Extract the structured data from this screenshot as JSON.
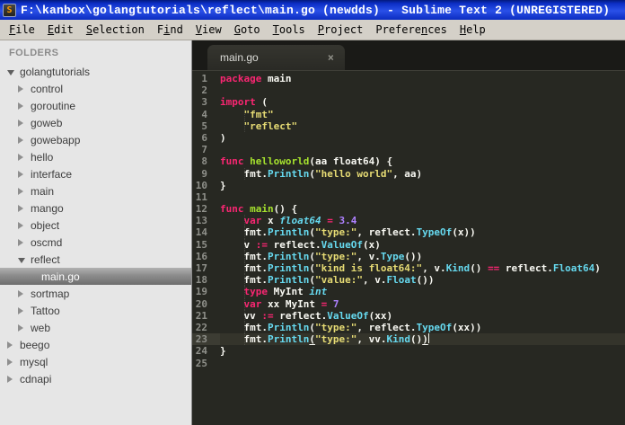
{
  "window": {
    "title": "F:\\kanbox\\golangtutorials\\reflect\\main.go (newdds) - Sublime Text 2 (UNREGISTERED)",
    "icon_letter": "S"
  },
  "menu": {
    "items": [
      {
        "label": "File",
        "mnemonic_index": 0
      },
      {
        "label": "Edit",
        "mnemonic_index": 0
      },
      {
        "label": "Selection",
        "mnemonic_index": 0
      },
      {
        "label": "Find",
        "mnemonic_index": 1
      },
      {
        "label": "View",
        "mnemonic_index": 0
      },
      {
        "label": "Goto",
        "mnemonic_index": 0
      },
      {
        "label": "Tools",
        "mnemonic_index": 0
      },
      {
        "label": "Project",
        "mnemonic_index": 0
      },
      {
        "label": "Preferences",
        "mnemonic_index": 7
      },
      {
        "label": "Help",
        "mnemonic_index": 0
      }
    ]
  },
  "sidebar": {
    "header": "FOLDERS",
    "items": [
      {
        "label": "golangtutorials",
        "level": 0,
        "state": "expanded",
        "selected": false
      },
      {
        "label": "control",
        "level": 1,
        "state": "collapsed",
        "selected": false
      },
      {
        "label": "goroutine",
        "level": 1,
        "state": "collapsed",
        "selected": false
      },
      {
        "label": "goweb",
        "level": 1,
        "state": "collapsed",
        "selected": false
      },
      {
        "label": "gowebapp",
        "level": 1,
        "state": "collapsed",
        "selected": false
      },
      {
        "label": "hello",
        "level": 1,
        "state": "collapsed",
        "selected": false
      },
      {
        "label": "interface",
        "level": 1,
        "state": "collapsed",
        "selected": false
      },
      {
        "label": "main",
        "level": 1,
        "state": "collapsed",
        "selected": false
      },
      {
        "label": "mango",
        "level": 1,
        "state": "collapsed",
        "selected": false
      },
      {
        "label": "object",
        "level": 1,
        "state": "collapsed",
        "selected": false
      },
      {
        "label": "oscmd",
        "level": 1,
        "state": "collapsed",
        "selected": false
      },
      {
        "label": "reflect",
        "level": 1,
        "state": "expanded",
        "selected": false
      },
      {
        "label": "main.go",
        "level": 2,
        "state": "file",
        "selected": true
      },
      {
        "label": "sortmap",
        "level": 1,
        "state": "collapsed",
        "selected": false
      },
      {
        "label": "Tattoo",
        "level": 1,
        "state": "collapsed",
        "selected": false
      },
      {
        "label": "web",
        "level": 1,
        "state": "collapsed",
        "selected": false
      },
      {
        "label": "beego",
        "level": 0,
        "state": "collapsed",
        "selected": false
      },
      {
        "label": "mysql",
        "level": 0,
        "state": "collapsed",
        "selected": false
      },
      {
        "label": "cdnapi",
        "level": 0,
        "state": "collapsed",
        "selected": false
      }
    ]
  },
  "tabbar": {
    "tab_label": "main.go",
    "close_icon": "×"
  },
  "editor": {
    "language": "go",
    "theme_colors": {
      "background": "#272822",
      "keyword": "#f92672",
      "function_name": "#a6e22e",
      "type": "#66d9ef",
      "string": "#e6db74",
      "number": "#ae81ff",
      "plain": "#f8f8f2",
      "line_number": "#8f908a",
      "current_line": "#34342b"
    },
    "lines": [
      {
        "num": 1,
        "tokens": [
          [
            "k",
            "package"
          ],
          [
            "p",
            " main"
          ]
        ]
      },
      {
        "num": 2,
        "tokens": []
      },
      {
        "num": 3,
        "tokens": [
          [
            "k",
            "import"
          ],
          [
            "p",
            " ("
          ]
        ]
      },
      {
        "num": 4,
        "tokens": [
          [
            "p",
            "    "
          ],
          [
            "s",
            "\"fmt\""
          ]
        ]
      },
      {
        "num": 5,
        "tokens": [
          [
            "p",
            "    "
          ],
          [
            "s",
            "\"reflect\""
          ]
        ]
      },
      {
        "num": 6,
        "tokens": [
          [
            "p",
            ")"
          ]
        ]
      },
      {
        "num": 7,
        "tokens": []
      },
      {
        "num": 8,
        "tokens": [
          [
            "k",
            "func"
          ],
          [
            "p",
            " "
          ],
          [
            "f",
            "helloworld"
          ],
          [
            "p",
            "(aa float64) {"
          ]
        ]
      },
      {
        "num": 9,
        "tokens": [
          [
            "p",
            "    fmt."
          ],
          [
            "m",
            "Println"
          ],
          [
            "p",
            "("
          ],
          [
            "s",
            "\"hello world\""
          ],
          [
            "p",
            ", aa)"
          ]
        ]
      },
      {
        "num": 10,
        "tokens": [
          [
            "p",
            "}"
          ]
        ]
      },
      {
        "num": 11,
        "tokens": []
      },
      {
        "num": 12,
        "tokens": [
          [
            "k",
            "func"
          ],
          [
            "p",
            " "
          ],
          [
            "f",
            "main"
          ],
          [
            "p",
            "() {"
          ]
        ]
      },
      {
        "num": 13,
        "tokens": [
          [
            "p",
            "    "
          ],
          [
            "k",
            "var"
          ],
          [
            "p",
            " x "
          ],
          [
            "t",
            "float64"
          ],
          [
            "p",
            " "
          ],
          [
            "o",
            "="
          ],
          [
            "p",
            " "
          ],
          [
            "n",
            "3.4"
          ]
        ]
      },
      {
        "num": 14,
        "tokens": [
          [
            "p",
            "    fmt."
          ],
          [
            "m",
            "Println"
          ],
          [
            "p",
            "("
          ],
          [
            "s",
            "\"type:\""
          ],
          [
            "p",
            ", reflect."
          ],
          [
            "m",
            "TypeOf"
          ],
          [
            "p",
            "(x))"
          ]
        ]
      },
      {
        "num": 15,
        "tokens": [
          [
            "p",
            "    v "
          ],
          [
            "o",
            ":="
          ],
          [
            "p",
            " reflect."
          ],
          [
            "m",
            "ValueOf"
          ],
          [
            "p",
            "(x)"
          ]
        ]
      },
      {
        "num": 16,
        "tokens": [
          [
            "p",
            "    fmt."
          ],
          [
            "m",
            "Println"
          ],
          [
            "p",
            "("
          ],
          [
            "s",
            "\"type:\""
          ],
          [
            "p",
            ", v."
          ],
          [
            "m",
            "Type"
          ],
          [
            "p",
            "())"
          ]
        ]
      },
      {
        "num": 17,
        "tokens": [
          [
            "p",
            "    fmt."
          ],
          [
            "m",
            "Println"
          ],
          [
            "p",
            "("
          ],
          [
            "s",
            "\"kind is float64:\""
          ],
          [
            "p",
            ", v."
          ],
          [
            "m",
            "Kind"
          ],
          [
            "p",
            "() "
          ],
          [
            "o",
            "=="
          ],
          [
            "p",
            " reflect."
          ],
          [
            "m",
            "Float64"
          ],
          [
            "p",
            ")"
          ]
        ]
      },
      {
        "num": 18,
        "tokens": [
          [
            "p",
            "    fmt."
          ],
          [
            "m",
            "Println"
          ],
          [
            "p",
            "("
          ],
          [
            "s",
            "\"value:\""
          ],
          [
            "p",
            ", v."
          ],
          [
            "m",
            "Float"
          ],
          [
            "p",
            "())"
          ]
        ]
      },
      {
        "num": 19,
        "tokens": [
          [
            "p",
            "    "
          ],
          [
            "k",
            "type"
          ],
          [
            "p",
            " MyInt "
          ],
          [
            "t",
            "int"
          ]
        ]
      },
      {
        "num": 20,
        "tokens": [
          [
            "p",
            "    "
          ],
          [
            "k",
            "var"
          ],
          [
            "p",
            " xx MyInt "
          ],
          [
            "o",
            "="
          ],
          [
            "p",
            " "
          ],
          [
            "n",
            "7"
          ]
        ]
      },
      {
        "num": 21,
        "tokens": [
          [
            "p",
            "    vv "
          ],
          [
            "o",
            ":="
          ],
          [
            "p",
            " reflect."
          ],
          [
            "m",
            "ValueOf"
          ],
          [
            "p",
            "(xx)"
          ]
        ]
      },
      {
        "num": 22,
        "tokens": [
          [
            "p",
            "    fmt."
          ],
          [
            "m",
            "Println"
          ],
          [
            "p",
            "("
          ],
          [
            "s",
            "\"type:\""
          ],
          [
            "p",
            ", reflect."
          ],
          [
            "m",
            "TypeOf"
          ],
          [
            "p",
            "(xx))"
          ]
        ]
      },
      {
        "num": 23,
        "tokens": [
          [
            "p",
            "    fmt."
          ],
          [
            "m",
            "Println"
          ],
          [
            "u",
            "("
          ],
          [
            "s",
            "\"type:\""
          ],
          [
            "p",
            ", vv."
          ],
          [
            "m",
            "Kind"
          ],
          [
            "p",
            "()"
          ],
          [
            "u",
            ")"
          ]
        ],
        "current": true,
        "caret": true
      },
      {
        "num": 24,
        "tokens": [
          [
            "p",
            "}"
          ]
        ]
      },
      {
        "num": 25,
        "tokens": []
      }
    ]
  }
}
